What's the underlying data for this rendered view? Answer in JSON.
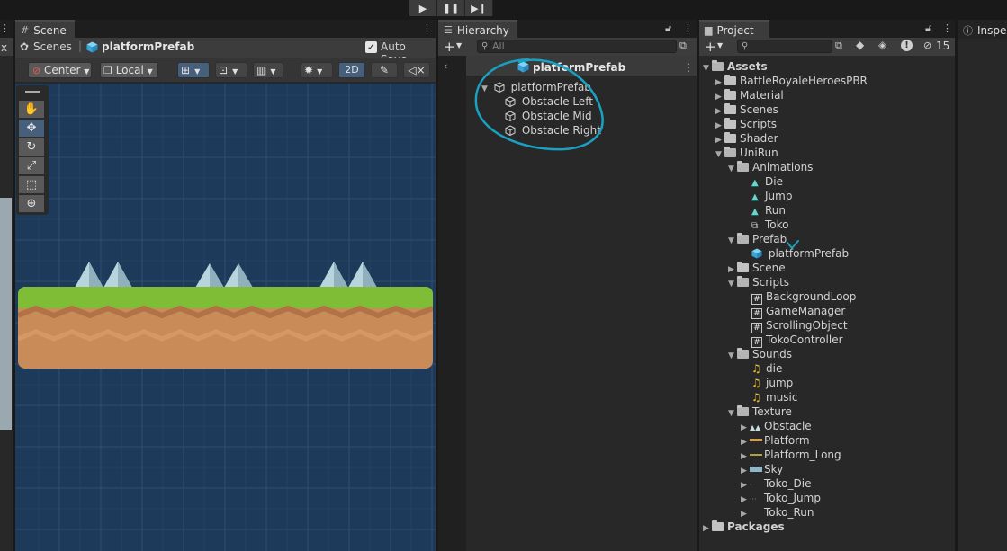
{
  "toolbar": {
    "play_icon": "play-icon",
    "pause_icon": "pause-icon",
    "step_icon": "step-icon"
  },
  "scene": {
    "tab_label": "Scene",
    "breadcrumb_root": "Scenes",
    "breadcrumb_prefab": "platformPrefab",
    "auto_save_label": "Auto Save",
    "pivot_label": "Center",
    "space_label": "Local",
    "mode_2d_label": "2D",
    "left_stub_text": "x"
  },
  "hierarchy": {
    "tab_label": "Hierarchy",
    "search_placeholder": "All",
    "header_title": "platformPrefab",
    "root_item": "platformPrefab",
    "children": [
      "Obstacle Left",
      "Obstacle Mid",
      "Obstacle Right"
    ]
  },
  "project": {
    "tab_label": "Project",
    "hidden_count": "15",
    "assets_label": "Assets",
    "packages_label": "Packages",
    "top_folders": [
      "BattleRoyaleHeroesPBR",
      "Material",
      "Scenes",
      "Scripts",
      "Shader"
    ],
    "unirun": "UniRun",
    "animations_folder": "Animations",
    "animations": [
      "Die",
      "Jump",
      "Run",
      "Toko"
    ],
    "prefab_folder": "Prefab",
    "prefab_item": "platformPrefab",
    "scene_folder": "Scene",
    "scripts_folder": "Scripts",
    "scripts": [
      "BackgroundLoop",
      "GameManager",
      "ScrollingObject",
      "TokoController"
    ],
    "sounds_folder": "Sounds",
    "sounds": [
      "die",
      "jump",
      "music"
    ],
    "texture_folder": "Texture",
    "textures": [
      "Obstacle",
      "Platform",
      "Platform_Long",
      "Sky",
      "Toko_Die",
      "Toko_Jump",
      "Toko_Run"
    ]
  },
  "inspector": {
    "tab_label": "Inspe"
  },
  "colors": {
    "annotation": "#1aa0c0",
    "scene_bg": "#1e3a5a",
    "grass": "#7dbb35",
    "dirt": "#c88a55"
  }
}
